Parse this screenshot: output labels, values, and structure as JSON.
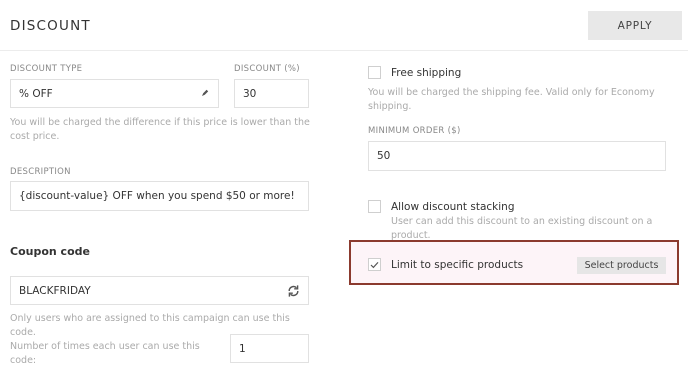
{
  "header": {
    "title": "DISCOUNT",
    "apply_label": "APPLY"
  },
  "left": {
    "discount_type": {
      "label": "DISCOUNT TYPE",
      "value": "% OFF",
      "icon": "pencil-icon"
    },
    "discount_pct": {
      "label": "DISCOUNT (%)",
      "value": "30"
    },
    "discount_help": "You will be charged the difference if this price is lower than the cost price.",
    "description": {
      "label": "DESCRIPTION",
      "value": "{discount-value} OFF when you spend $50 or more!"
    },
    "coupon": {
      "title": "Coupon code",
      "value": "BLACKFRIDAY",
      "icon": "refresh-icon",
      "help": "Only users who are assigned to this campaign can use this code."
    },
    "uses_per_user": {
      "label": "Number of times each user can use this code:",
      "value": "1"
    }
  },
  "right": {
    "free_shipping": {
      "label": "Free shipping",
      "checked": false,
      "help": "You will be charged the shipping fee. Valid only for Economy shipping."
    },
    "minimum_order": {
      "label": "MINIMUM ORDER ($)",
      "value": "50"
    },
    "stacking": {
      "label": "Allow discount stacking",
      "checked": false,
      "help": "User can add this discount to an existing discount on a product."
    },
    "limit_products": {
      "label": "Limit to specific products",
      "checked": true,
      "button_label": "Select products"
    }
  },
  "colors": {
    "highlight_border": "#8b3a2e",
    "highlight_bg": "#fdf4f8",
    "button_bg": "#e8e8e8"
  }
}
